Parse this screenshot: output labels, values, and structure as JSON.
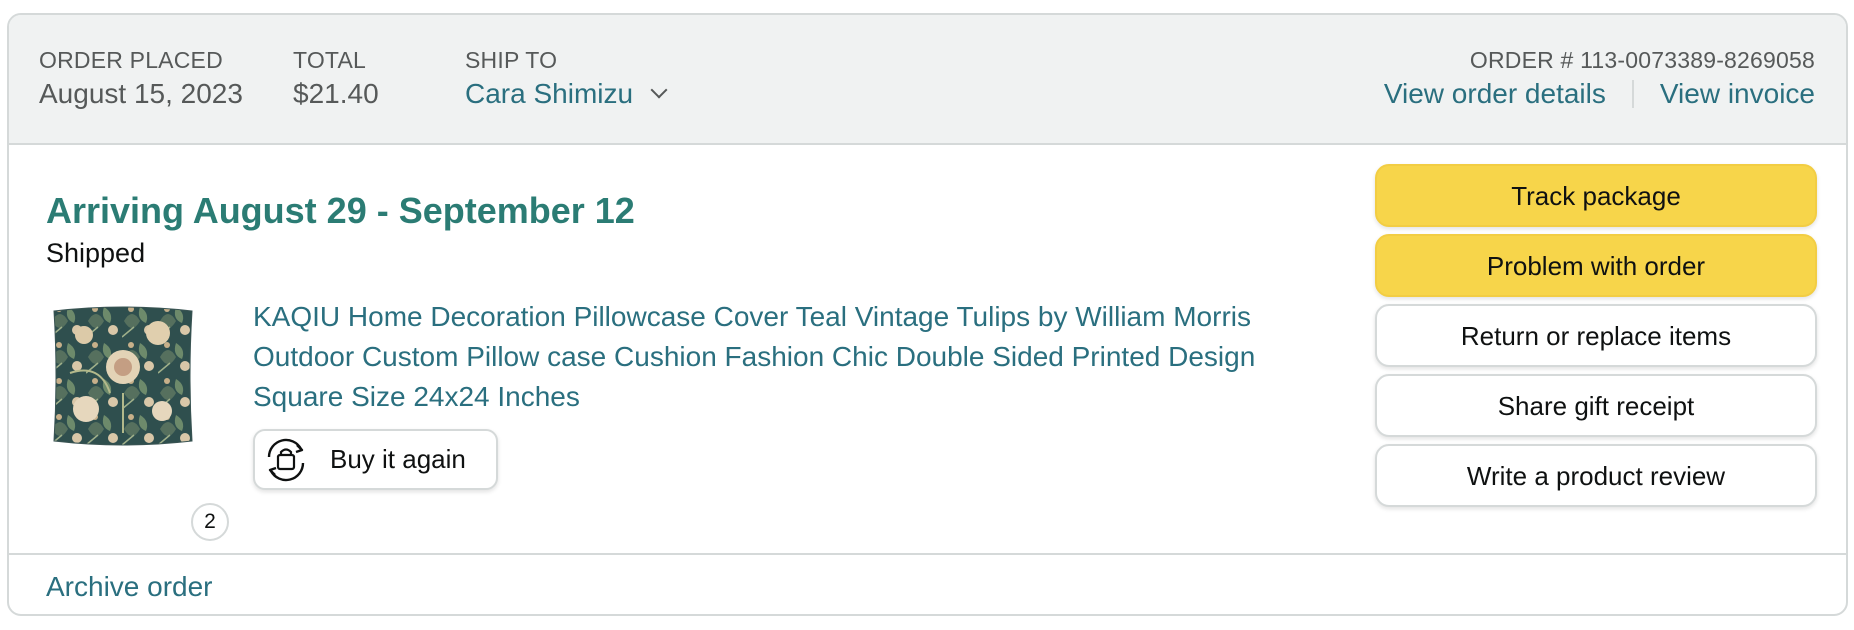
{
  "header": {
    "order_placed_label": "ORDER PLACED",
    "order_placed_value": "August 15, 2023",
    "total_label": "TOTAL",
    "total_value": "$21.40",
    "ship_to_label": "SHIP TO",
    "ship_to_value": "Cara Shimizu",
    "ship_to_icon": "chevron-down-icon",
    "order_number": "ORDER # 113-0073389-8269058",
    "view_order_details": "View order details",
    "view_invoice": "View invoice"
  },
  "shipment": {
    "title": "Arriving August 29 - September 12",
    "status": "Shipped"
  },
  "item": {
    "title": "KAQIU Home Decoration Pillowcase Cover Teal Vintage Tulips by William Morris Outdoor Custom Pillow case Cushion Fashion Chic Double Sided Printed Design Square Size 24x24 Inches",
    "quantity": "2",
    "buy_again_label": "Buy it again",
    "buy_again_icon": "buy-again-icon"
  },
  "actions": {
    "track_package": "Track package",
    "problem_with_order": "Problem with order",
    "return_or_replace": "Return or replace items",
    "share_gift_receipt": "Share gift receipt",
    "write_review": "Write a product review"
  },
  "footer": {
    "archive_order": "Archive order"
  },
  "colors": {
    "link": "#2a6f7f",
    "delivery_title": "#2b7c74",
    "primary_button": "#f7d54a",
    "header_bg": "#f0f2f2",
    "border": "#d5d9d9"
  }
}
